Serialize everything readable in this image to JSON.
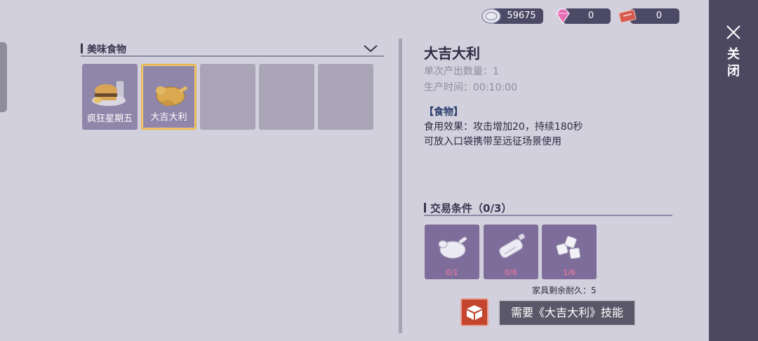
{
  "currencies": [
    {
      "icon": "silver-coin-icon",
      "value": "59675"
    },
    {
      "icon": "pink-diamond-icon",
      "value": "0"
    },
    {
      "icon": "red-ticket-icon",
      "value": "0"
    }
  ],
  "category": {
    "label": "美味食物",
    "dropdown_icon": "chevron-down-icon"
  },
  "items": [
    {
      "name": "疯狂星期五",
      "icon": "burger-meal-icon",
      "state": "filled"
    },
    {
      "name": "大吉大利",
      "icon": "roast-chicken-icon",
      "state": "selected"
    },
    {
      "name": "",
      "state": "empty"
    },
    {
      "name": "",
      "state": "empty"
    },
    {
      "name": "",
      "state": "empty"
    }
  ],
  "detail": {
    "title": "大吉大利",
    "output": "单次产出数量：1",
    "time": "生产时间：00:10:00",
    "tag": "【食物】",
    "desc_line1": "食用效果：攻击增加20，持续180秒",
    "desc_line2": "可放入口袋携带至远征场景使用"
  },
  "trade": {
    "label": "交易条件（0/3）",
    "requirements": [
      {
        "icon": "raw-chicken-icon",
        "count": "0/1"
      },
      {
        "icon": "bottle-icon",
        "count": "0/6"
      },
      {
        "icon": "ice-cubes-icon",
        "count": "1/6"
      }
    ]
  },
  "durability": "家具剩余耐久：5",
  "craft_icon": "crafting-box-icon",
  "skill_button": "需要《大吉大利》技能",
  "close_label": "关闭",
  "colors": {
    "accent_selected": "#e8b64c",
    "craft_button": "#c4462f",
    "count_text": "#ff7aa0",
    "tag_text": "#2a3c6c"
  }
}
